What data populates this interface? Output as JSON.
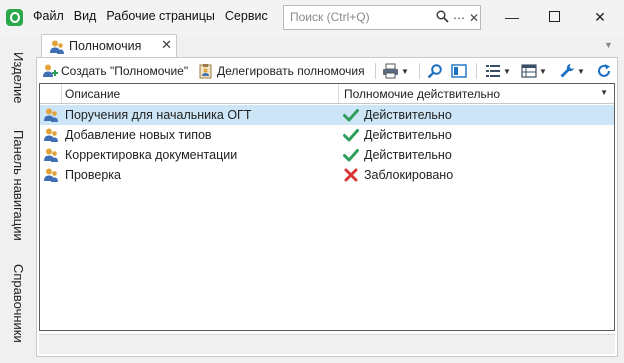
{
  "menu": [
    {
      "label": "Файл"
    },
    {
      "label": "Вид"
    },
    {
      "label": "Рабочие страницы"
    },
    {
      "label": "Сервис"
    }
  ],
  "search": {
    "placeholder": "Поиск (Ctrl+Q)"
  },
  "sidebar": {
    "tabs": [
      {
        "label": "Изделие"
      },
      {
        "label": "Панель навигации"
      },
      {
        "label": "Справочники"
      }
    ]
  },
  "doc_tab": {
    "label": "Полномочия"
  },
  "toolbar": {
    "create_label": "Создать \"Полномочие\"",
    "delegate_label": "Делегировать полномочия"
  },
  "table": {
    "columns": [
      "Описание",
      "Полномочие действительно"
    ],
    "rows": [
      {
        "description": "Поручения для начальника ОГТ",
        "status": "Действительно",
        "status_icon": "check-icon",
        "selected": true
      },
      {
        "description": "Добавление новых типов",
        "status": "Действительно",
        "status_icon": "check-icon",
        "selected": false
      },
      {
        "description": "Корректировка документации",
        "status": "Действительно",
        "status_icon": "check-icon",
        "selected": false
      },
      {
        "description": "Проверка",
        "status": "Заблокировано",
        "status_icon": "cross-icon",
        "selected": false
      }
    ]
  },
  "colors": {
    "selected_row": "#cde6f7",
    "valid": "#2e9e5b",
    "blocked": "#d93636",
    "accent": "#1d6fc4"
  }
}
